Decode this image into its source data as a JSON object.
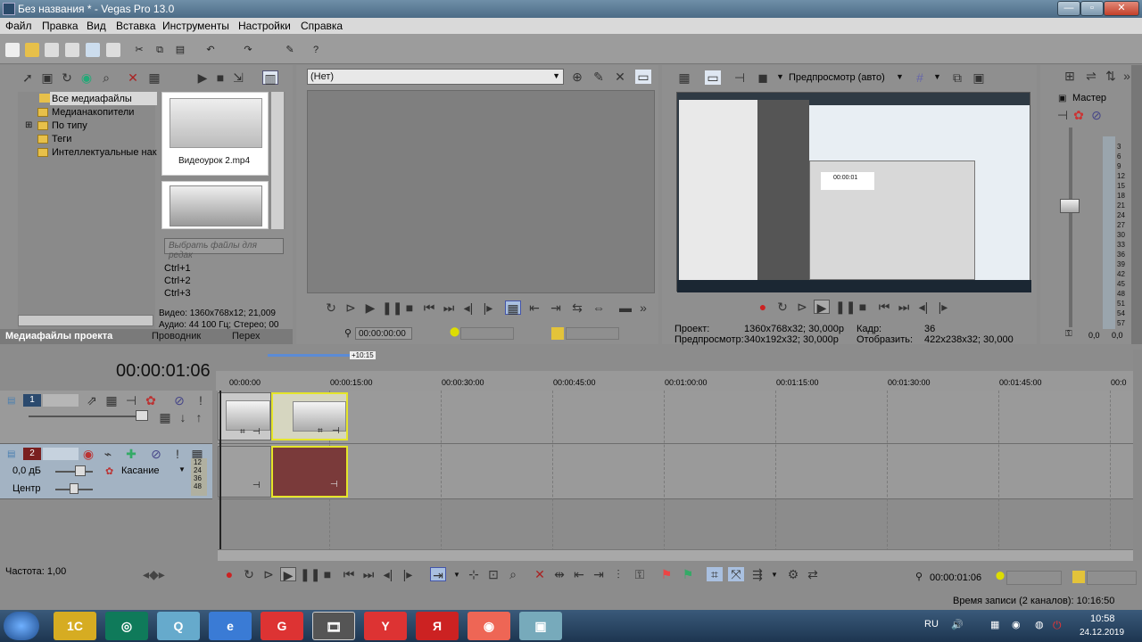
{
  "window": {
    "title": "Без названия * - Vegas Pro 13.0",
    "min": "—",
    "max": "▫",
    "close": "✕"
  },
  "menu": [
    "Файл",
    "Правка",
    "Вид",
    "Вставка",
    "Инструменты",
    "Настройки",
    "Справка"
  ],
  "explorer": {
    "tree": [
      "Все медиафайлы",
      "Медианакопители",
      "По типу",
      "Теги",
      "Интеллектуальные нак"
    ],
    "thumb_label": "Видеоурок 2.mp4",
    "search_placeholder": "Выбрать файлы для редак",
    "shortcuts": [
      "Ctrl+1",
      "Ctrl+2",
      "Ctrl+3"
    ],
    "info_video": "Видео: 1360x768x12; 21,009",
    "info_audio": "Аудио: 44 100 Гц; Стерео; 00",
    "tabs": [
      "Медиафайлы проекта",
      "Проводник",
      "Перех"
    ]
  },
  "trimmer": {
    "dropdown": "(Нет)",
    "timecode": "00:00:00:00"
  },
  "preview": {
    "mode": "Предпросмотр (авто)",
    "project_label": "Проект:",
    "project_value": "1360x768x32; 30,000p",
    "preview_label": "Предпросмотр:",
    "preview_value": "340x192x32; 30,000p",
    "frame_label": "Кадр:",
    "frame_value": "36",
    "display_label": "Отобразить:",
    "display_value": "422x238x32; 30,000",
    "screen_time": "00:00:01"
  },
  "master": {
    "label": "Мастер",
    "scale": [
      "3",
      "6",
      "9",
      "12",
      "15",
      "18",
      "21",
      "24",
      "27",
      "30",
      "33",
      "36",
      "39",
      "42",
      "45",
      "48",
      "51",
      "54",
      "57"
    ],
    "left_val": "0,0",
    "right_val": "0,0"
  },
  "timeline": {
    "timecode": "00:00:01:06",
    "loop_label": "+10:15",
    "ruler": [
      "00:00:00",
      "00:00:15:00",
      "00:00:30:00",
      "00:00:45:00",
      "00:01:00:00",
      "00:01:15:00",
      "00:01:30:00",
      "00:01:45:00",
      "00:0"
    ],
    "track1_num": "1",
    "track2_num": "2",
    "volume": "0,0 дБ",
    "pan": "Центр",
    "touch": "Касание",
    "meter_ticks": [
      "12",
      "24",
      "36",
      "48"
    ],
    "rate": "Частота: 1,00",
    "cursor_time": "00:00:01:06",
    "record_time": "Время записи (2 каналов): 10:16:50"
  },
  "taskbar": {
    "lang": "RU",
    "time": "10:58",
    "date": "24.12.2019",
    "apps": [
      "1C",
      "◎",
      "Q",
      "e",
      "G",
      "🎞",
      "Y",
      "Я",
      "◉",
      "▣"
    ]
  },
  "colors": {
    "accent": "#4a7fb0",
    "audio_clip": "#7a3a3a",
    "clip_border": "#e5e52a"
  }
}
